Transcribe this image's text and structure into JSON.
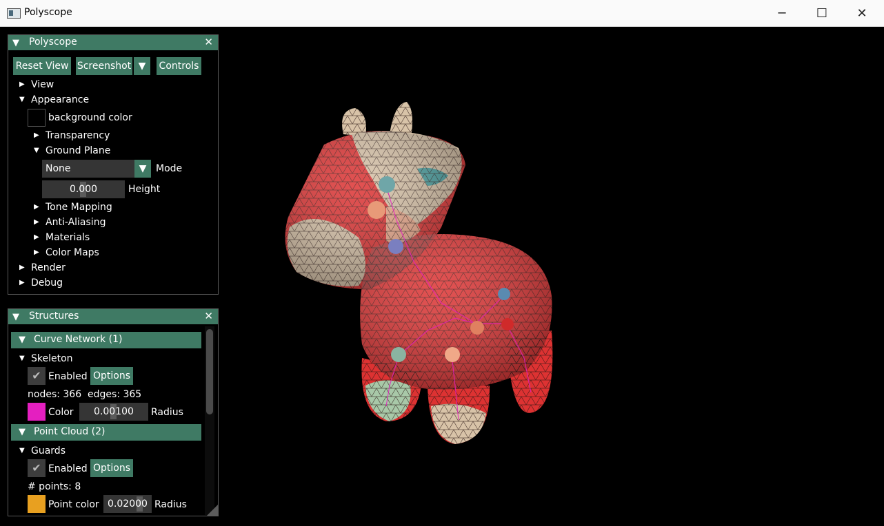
{
  "window": {
    "title": "Polyscope",
    "minimize_glyph": "─",
    "maximize_glyph": "☐",
    "close_glyph": "✕"
  },
  "icons": {
    "expanded": "▼",
    "collapsed": "▶",
    "close": "✕",
    "check": "✔",
    "dropdown": "▼"
  },
  "polyscope_panel": {
    "title": "Polyscope",
    "buttons": {
      "reset_view": "Reset View",
      "screenshot": "Screenshot",
      "controls": "Controls"
    },
    "tree": {
      "view": "View",
      "appearance": "Appearance",
      "background_color_label": "background color",
      "background_color": "#000000",
      "transparency": "Transparency",
      "ground_plane": "Ground Plane",
      "mode_value": "None",
      "mode_label": "Mode",
      "height_value": "0.000",
      "height_label": "Height",
      "tone_mapping": "Tone Mapping",
      "anti_aliasing": "Anti-Aliasing",
      "materials": "Materials",
      "color_maps": "Color Maps",
      "render": "Render",
      "debug": "Debug"
    }
  },
  "structures_panel": {
    "title": "Structures",
    "curve_network": {
      "header": "Curve Network (1)",
      "name": "Skeleton",
      "enabled_label": "Enabled",
      "options_label": "Options",
      "stats": "nodes: 366  edges: 365",
      "color_label": "Color",
      "color": "#e41fc0",
      "radius_value": "0.00100",
      "radius_label": "Radius"
    },
    "point_cloud": {
      "header": "Point Cloud (2)",
      "name": "Guards",
      "enabled_label": "Enabled",
      "options_label": "Options",
      "stats": "# points: 8",
      "color_label": "Point color",
      "color": "#e8a020",
      "radius_value": "0.02000",
      "radius_label": "Radius"
    }
  },
  "scene": {
    "mesh_color": "#dd3232",
    "mesh_alt_color": "#d8c3a8",
    "edge_color": "#2a1512",
    "skeleton_color": "#e41fc0",
    "point_color": "#e8a020"
  }
}
